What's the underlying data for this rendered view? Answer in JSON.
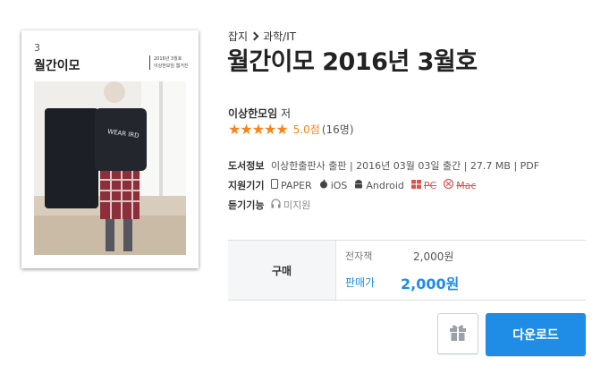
{
  "colors": {
    "accent": "#1f8ce6",
    "star": "#f5841f",
    "strike": "#d9534f"
  },
  "breadcrumb": {
    "category": "잡지",
    "subcategory": "과학/IT"
  },
  "book": {
    "title": "월간이모 2016년 3월호",
    "author": "이상한모임",
    "author_suffix": "저",
    "rating": {
      "stars": 5,
      "score_text": "5.0점",
      "count_text": "(16명)"
    }
  },
  "cover": {
    "issue_number": "3",
    "title": "월간이모",
    "sub_line1": "2016년 3월호",
    "sub_line2": "이상한모임 웹거진",
    "shirt_text": "WEAR IRD"
  },
  "info": {
    "book_info_label": "도서정보",
    "book_info_value": "이상한출판사 출판 | 2016년 03월 03일 출간 | 27.7 MB | PDF",
    "support_label": "지원기기",
    "platforms": [
      {
        "icon": "tablet-icon",
        "label": "PAPER",
        "supported": true
      },
      {
        "icon": "apple-icon",
        "label": "iOS",
        "supported": true
      },
      {
        "icon": "android-icon",
        "label": "Android",
        "supported": true
      },
      {
        "icon": "windows-icon",
        "label": "PC",
        "supported": false
      },
      {
        "icon": "mac-icon",
        "label": "Mac",
        "supported": false
      }
    ],
    "listen_label": "듣기기능",
    "listen_value": "미지원"
  },
  "price": {
    "purchase_label": "구매",
    "ebook_label": "전자책",
    "ebook_price": "2,000원",
    "sale_label": "판매가",
    "sale_price": "2,000원"
  },
  "actions": {
    "download_label": "다운로드"
  }
}
